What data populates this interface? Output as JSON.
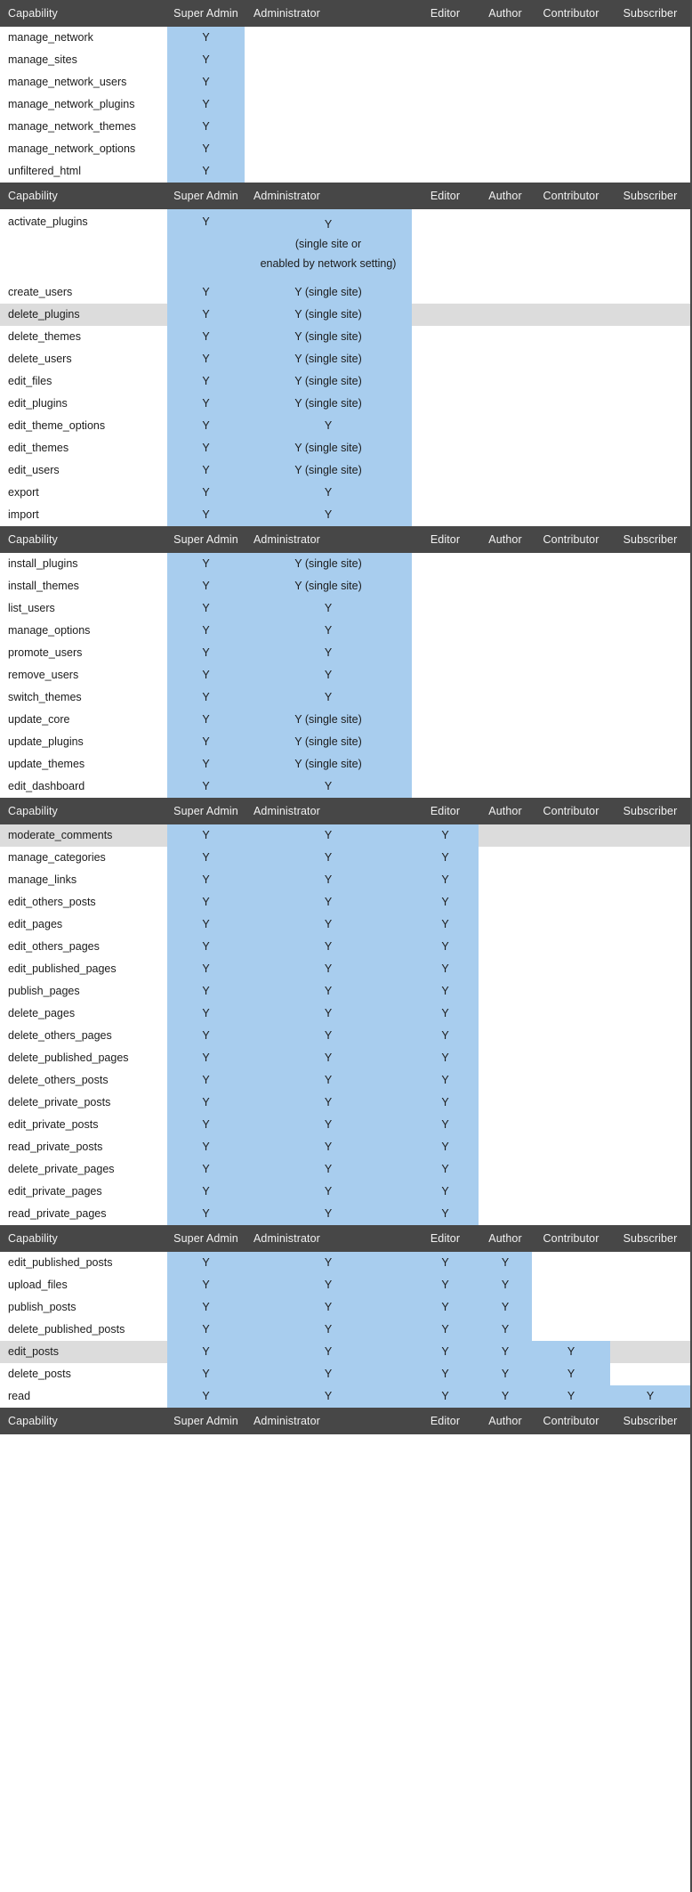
{
  "colors": {
    "header_bg": "#474747",
    "header_text": "#f2f2f2",
    "highlight": "#a8cdee",
    "alt_row": "#dcdcdc",
    "body_text": "#1b1b1b",
    "page_bg": "#ffffff"
  },
  "columns": [
    "Capability",
    "Super Admin",
    "Administrator",
    "Editor",
    "Author",
    "Contributor",
    "Subscriber"
  ],
  "sections": [
    {
      "id": "network",
      "header": [
        "Capability",
        "Super Admin",
        "Administrator",
        "Editor",
        "Author",
        "Contributor",
        "Subscriber"
      ],
      "highlight_through": 1,
      "rows": [
        {
          "capability": "manage_network",
          "alt": false,
          "values": [
            "Y",
            "",
            "",
            "",
            "",
            ""
          ]
        },
        {
          "capability": "manage_sites",
          "alt": false,
          "values": [
            "Y",
            "",
            "",
            "",
            "",
            ""
          ]
        },
        {
          "capability": "manage_network_users",
          "alt": false,
          "values": [
            "Y",
            "",
            "",
            "",
            "",
            ""
          ]
        },
        {
          "capability": "manage_network_plugins",
          "alt": false,
          "values": [
            "Y",
            "",
            "",
            "",
            "",
            ""
          ]
        },
        {
          "capability": "manage_network_themes",
          "alt": false,
          "values": [
            "Y",
            "",
            "",
            "",
            "",
            ""
          ]
        },
        {
          "capability": "manage_network_options",
          "alt": false,
          "values": [
            "Y",
            "",
            "",
            "",
            "",
            ""
          ]
        },
        {
          "capability": "unfiltered_html",
          "alt": false,
          "values": [
            "Y",
            "",
            "",
            "",
            "",
            ""
          ]
        }
      ]
    },
    {
      "id": "admin-a",
      "header": [
        "Capability",
        "Super Admin",
        "Administrator",
        "Editor",
        "Author",
        "Contributor",
        "Subscriber"
      ],
      "highlight_through": 2,
      "rows": [
        {
          "capability": "activate_plugins",
          "alt": false,
          "tall": true,
          "values": [
            "Y",
            [
              "Y",
              "(single site or",
              "enabled by network setting)"
            ],
            "",
            "",
            "",
            ""
          ]
        },
        {
          "capability": "create_users",
          "alt": false,
          "values": [
            "Y",
            "Y (single site)",
            "",
            "",
            "",
            ""
          ]
        },
        {
          "capability": "delete_plugins",
          "alt": true,
          "values": [
            "Y",
            "Y (single site)",
            "",
            "",
            "",
            ""
          ]
        },
        {
          "capability": "delete_themes",
          "alt": false,
          "values": [
            "Y",
            "Y (single site)",
            "",
            "",
            "",
            ""
          ]
        },
        {
          "capability": "delete_users",
          "alt": false,
          "values": [
            "Y",
            "Y (single site)",
            "",
            "",
            "",
            ""
          ]
        },
        {
          "capability": "edit_files",
          "alt": false,
          "values": [
            "Y",
            "Y (single site)",
            "",
            "",
            "",
            ""
          ]
        },
        {
          "capability": "edit_plugins",
          "alt": false,
          "values": [
            "Y",
            "Y (single site)",
            "",
            "",
            "",
            ""
          ]
        },
        {
          "capability": "edit_theme_options",
          "alt": false,
          "values": [
            "Y",
            "Y",
            "",
            "",
            "",
            ""
          ]
        },
        {
          "capability": "edit_themes",
          "alt": false,
          "values": [
            "Y",
            "Y (single site)",
            "",
            "",
            "",
            ""
          ]
        },
        {
          "capability": "edit_users",
          "alt": false,
          "values": [
            "Y",
            "Y (single site)",
            "",
            "",
            "",
            ""
          ]
        },
        {
          "capability": "export",
          "alt": false,
          "values": [
            "Y",
            "Y",
            "",
            "",
            "",
            ""
          ]
        },
        {
          "capability": "import",
          "alt": false,
          "values": [
            "Y",
            "Y",
            "",
            "",
            "",
            ""
          ]
        }
      ]
    },
    {
      "id": "admin-b",
      "header": [
        "Capability",
        "Super Admin",
        "Administrator",
        "Editor",
        "Author",
        "Contributor",
        "Subscriber"
      ],
      "highlight_through": 2,
      "rows": [
        {
          "capability": "install_plugins",
          "alt": false,
          "values": [
            "Y",
            "Y (single site)",
            "",
            "",
            "",
            ""
          ]
        },
        {
          "capability": "install_themes",
          "alt": false,
          "values": [
            "Y",
            "Y (single site)",
            "",
            "",
            "",
            ""
          ]
        },
        {
          "capability": "list_users",
          "alt": false,
          "values": [
            "Y",
            "Y",
            "",
            "",
            "",
            ""
          ]
        },
        {
          "capability": "manage_options",
          "alt": false,
          "values": [
            "Y",
            "Y",
            "",
            "",
            "",
            ""
          ]
        },
        {
          "capability": "promote_users",
          "alt": false,
          "values": [
            "Y",
            "Y",
            "",
            "",
            "",
            ""
          ]
        },
        {
          "capability": "remove_users",
          "alt": false,
          "values": [
            "Y",
            "Y",
            "",
            "",
            "",
            ""
          ]
        },
        {
          "capability": "switch_themes",
          "alt": false,
          "values": [
            "Y",
            "Y",
            "",
            "",
            "",
            ""
          ]
        },
        {
          "capability": "update_core",
          "alt": false,
          "values": [
            "Y",
            "Y (single site)",
            "",
            "",
            "",
            ""
          ]
        },
        {
          "capability": "update_plugins",
          "alt": false,
          "values": [
            "Y",
            "Y (single site)",
            "",
            "",
            "",
            ""
          ]
        },
        {
          "capability": "update_themes",
          "alt": false,
          "values": [
            "Y",
            "Y (single site)",
            "",
            "",
            "",
            ""
          ]
        },
        {
          "capability": "edit_dashboard",
          "alt": false,
          "values": [
            "Y",
            "Y",
            "",
            "",
            "",
            ""
          ]
        }
      ]
    },
    {
      "id": "editor",
      "header": [
        "Capability",
        "Super Admin",
        "Administrator",
        "Editor",
        "Author",
        "Contributor",
        "Subscriber"
      ],
      "highlight_through": 3,
      "rows": [
        {
          "capability": "moderate_comments",
          "alt": true,
          "values": [
            "Y",
            "Y",
            "Y",
            "",
            "",
            ""
          ]
        },
        {
          "capability": "manage_categories",
          "alt": false,
          "values": [
            "Y",
            "Y",
            "Y",
            "",
            "",
            ""
          ]
        },
        {
          "capability": "manage_links",
          "alt": false,
          "values": [
            "Y",
            "Y",
            "Y",
            "",
            "",
            ""
          ]
        },
        {
          "capability": "edit_others_posts",
          "alt": false,
          "values": [
            "Y",
            "Y",
            "Y",
            "",
            "",
            ""
          ]
        },
        {
          "capability": "edit_pages",
          "alt": false,
          "values": [
            "Y",
            "Y",
            "Y",
            "",
            "",
            ""
          ]
        },
        {
          "capability": "edit_others_pages",
          "alt": false,
          "values": [
            "Y",
            "Y",
            "Y",
            "",
            "",
            ""
          ]
        },
        {
          "capability": "edit_published_pages",
          "alt": false,
          "values": [
            "Y",
            "Y",
            "Y",
            "",
            "",
            ""
          ]
        },
        {
          "capability": "publish_pages",
          "alt": false,
          "values": [
            "Y",
            "Y",
            "Y",
            "",
            "",
            ""
          ]
        },
        {
          "capability": "delete_pages",
          "alt": false,
          "values": [
            "Y",
            "Y",
            "Y",
            "",
            "",
            ""
          ]
        },
        {
          "capability": "delete_others_pages",
          "alt": false,
          "values": [
            "Y",
            "Y",
            "Y",
            "",
            "",
            ""
          ]
        },
        {
          "capability": "delete_published_pages",
          "alt": false,
          "values": [
            "Y",
            "Y",
            "Y",
            "",
            "",
            ""
          ]
        },
        {
          "capability": "delete_others_posts",
          "alt": false,
          "values": [
            "Y",
            "Y",
            "Y",
            "",
            "",
            ""
          ]
        },
        {
          "capability": "delete_private_posts",
          "alt": false,
          "values": [
            "Y",
            "Y",
            "Y",
            "",
            "",
            ""
          ]
        },
        {
          "capability": "edit_private_posts",
          "alt": false,
          "values": [
            "Y",
            "Y",
            "Y",
            "",
            "",
            ""
          ]
        },
        {
          "capability": "read_private_posts",
          "alt": false,
          "values": [
            "Y",
            "Y",
            "Y",
            "",
            "",
            ""
          ]
        },
        {
          "capability": "delete_private_pages",
          "alt": false,
          "values": [
            "Y",
            "Y",
            "Y",
            "",
            "",
            ""
          ]
        },
        {
          "capability": "edit_private_pages",
          "alt": false,
          "values": [
            "Y",
            "Y",
            "Y",
            "",
            "",
            ""
          ]
        },
        {
          "capability": "read_private_pages",
          "alt": false,
          "values": [
            "Y",
            "Y",
            "Y",
            "",
            "",
            ""
          ]
        }
      ]
    },
    {
      "id": "author",
      "header": [
        "Capability",
        "Super Admin",
        "Administrator",
        "Editor",
        "Author",
        "Contributor",
        "Subscriber"
      ],
      "highlight_through": 0,
      "rows": [
        {
          "capability": "edit_published_posts",
          "alt": false,
          "hl": 4,
          "values": [
            "Y",
            "Y",
            "Y",
            "Y",
            "",
            ""
          ]
        },
        {
          "capability": "upload_files",
          "alt": false,
          "hl": 4,
          "values": [
            "Y",
            "Y",
            "Y",
            "Y",
            "",
            ""
          ]
        },
        {
          "capability": "publish_posts",
          "alt": false,
          "hl": 4,
          "values": [
            "Y",
            "Y",
            "Y",
            "Y",
            "",
            ""
          ]
        },
        {
          "capability": "delete_published_posts",
          "alt": false,
          "hl": 4,
          "values": [
            "Y",
            "Y",
            "Y",
            "Y",
            "",
            ""
          ]
        },
        {
          "capability": "edit_posts",
          "alt": true,
          "hl": 5,
          "values": [
            "Y",
            "Y",
            "Y",
            "Y",
            "Y",
            ""
          ]
        },
        {
          "capability": "delete_posts",
          "alt": false,
          "hl": 5,
          "values": [
            "Y",
            "Y",
            "Y",
            "Y",
            "Y",
            ""
          ]
        },
        {
          "capability": "read",
          "alt": false,
          "hl": 6,
          "values": [
            "Y",
            "Y",
            "Y",
            "Y",
            "Y",
            "Y"
          ]
        }
      ]
    },
    {
      "id": "footer",
      "header": [
        "Capability",
        "Super Admin",
        "Administrator",
        "Editor",
        "Author",
        "Contributor",
        "Subscriber"
      ],
      "highlight_through": 0,
      "rows": []
    }
  ]
}
